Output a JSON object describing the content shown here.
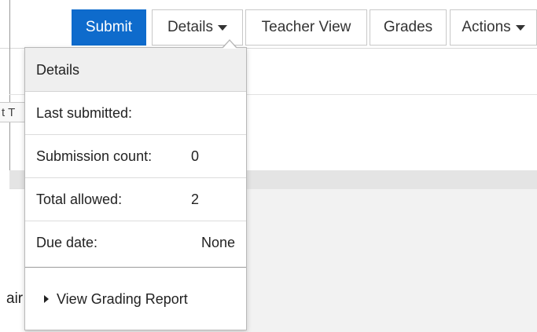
{
  "toolbar": {
    "submit_label": "Submit",
    "details_label": "Details",
    "teacher_view_label": "Teacher View",
    "grades_label": "Grades",
    "actions_label": "Actions"
  },
  "background": {
    "chip_text": "t T",
    "fragment_text": "air"
  },
  "details_popover": {
    "title": "Details",
    "rows": [
      {
        "label": "Last submitted:",
        "value": ""
      },
      {
        "label": "Submission count:",
        "value": "0"
      },
      {
        "label": "Total allowed:",
        "value": "2"
      },
      {
        "label": "Due date:",
        "value": "None"
      }
    ],
    "grading_report_label": "View Grading Report"
  },
  "colors": {
    "primary": "#0e6bcc",
    "header_bg": "#efefef"
  },
  "icons": {
    "details_caret": "chevron-down-icon",
    "actions_caret": "chevron-down-icon",
    "report_caret": "chevron-right-icon"
  }
}
